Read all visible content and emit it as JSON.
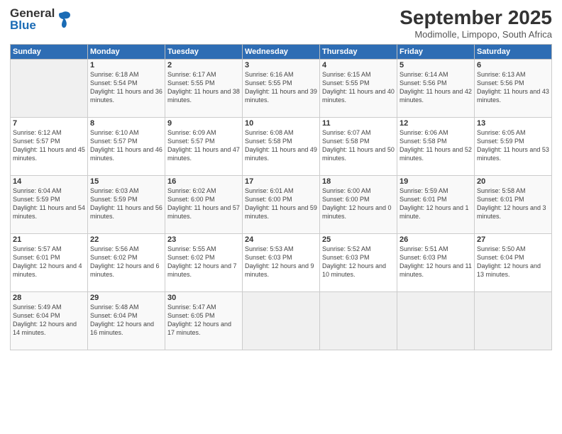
{
  "header": {
    "logo_general": "General",
    "logo_blue": "Blue",
    "month_title": "September 2025",
    "location": "Modimolle, Limpopo, South Africa"
  },
  "days_of_week": [
    "Sunday",
    "Monday",
    "Tuesday",
    "Wednesday",
    "Thursday",
    "Friday",
    "Saturday"
  ],
  "weeks": [
    [
      {
        "day": "",
        "sunrise": "",
        "sunset": "",
        "daylight": ""
      },
      {
        "day": "1",
        "sunrise": "Sunrise: 6:18 AM",
        "sunset": "Sunset: 5:54 PM",
        "daylight": "Daylight: 11 hours and 36 minutes."
      },
      {
        "day": "2",
        "sunrise": "Sunrise: 6:17 AM",
        "sunset": "Sunset: 5:55 PM",
        "daylight": "Daylight: 11 hours and 38 minutes."
      },
      {
        "day": "3",
        "sunrise": "Sunrise: 6:16 AM",
        "sunset": "Sunset: 5:55 PM",
        "daylight": "Daylight: 11 hours and 39 minutes."
      },
      {
        "day": "4",
        "sunrise": "Sunrise: 6:15 AM",
        "sunset": "Sunset: 5:55 PM",
        "daylight": "Daylight: 11 hours and 40 minutes."
      },
      {
        "day": "5",
        "sunrise": "Sunrise: 6:14 AM",
        "sunset": "Sunset: 5:56 PM",
        "daylight": "Daylight: 11 hours and 42 minutes."
      },
      {
        "day": "6",
        "sunrise": "Sunrise: 6:13 AM",
        "sunset": "Sunset: 5:56 PM",
        "daylight": "Daylight: 11 hours and 43 minutes."
      }
    ],
    [
      {
        "day": "7",
        "sunrise": "Sunrise: 6:12 AM",
        "sunset": "Sunset: 5:57 PM",
        "daylight": "Daylight: 11 hours and 45 minutes."
      },
      {
        "day": "8",
        "sunrise": "Sunrise: 6:10 AM",
        "sunset": "Sunset: 5:57 PM",
        "daylight": "Daylight: 11 hours and 46 minutes."
      },
      {
        "day": "9",
        "sunrise": "Sunrise: 6:09 AM",
        "sunset": "Sunset: 5:57 PM",
        "daylight": "Daylight: 11 hours and 47 minutes."
      },
      {
        "day": "10",
        "sunrise": "Sunrise: 6:08 AM",
        "sunset": "Sunset: 5:58 PM",
        "daylight": "Daylight: 11 hours and 49 minutes."
      },
      {
        "day": "11",
        "sunrise": "Sunrise: 6:07 AM",
        "sunset": "Sunset: 5:58 PM",
        "daylight": "Daylight: 11 hours and 50 minutes."
      },
      {
        "day": "12",
        "sunrise": "Sunrise: 6:06 AM",
        "sunset": "Sunset: 5:58 PM",
        "daylight": "Daylight: 11 hours and 52 minutes."
      },
      {
        "day": "13",
        "sunrise": "Sunrise: 6:05 AM",
        "sunset": "Sunset: 5:59 PM",
        "daylight": "Daylight: 11 hours and 53 minutes."
      }
    ],
    [
      {
        "day": "14",
        "sunrise": "Sunrise: 6:04 AM",
        "sunset": "Sunset: 5:59 PM",
        "daylight": "Daylight: 11 hours and 54 minutes."
      },
      {
        "day": "15",
        "sunrise": "Sunrise: 6:03 AM",
        "sunset": "Sunset: 5:59 PM",
        "daylight": "Daylight: 11 hours and 56 minutes."
      },
      {
        "day": "16",
        "sunrise": "Sunrise: 6:02 AM",
        "sunset": "Sunset: 6:00 PM",
        "daylight": "Daylight: 11 hours and 57 minutes."
      },
      {
        "day": "17",
        "sunrise": "Sunrise: 6:01 AM",
        "sunset": "Sunset: 6:00 PM",
        "daylight": "Daylight: 11 hours and 59 minutes."
      },
      {
        "day": "18",
        "sunrise": "Sunrise: 6:00 AM",
        "sunset": "Sunset: 6:00 PM",
        "daylight": "Daylight: 12 hours and 0 minutes."
      },
      {
        "day": "19",
        "sunrise": "Sunrise: 5:59 AM",
        "sunset": "Sunset: 6:01 PM",
        "daylight": "Daylight: 12 hours and 1 minute."
      },
      {
        "day": "20",
        "sunrise": "Sunrise: 5:58 AM",
        "sunset": "Sunset: 6:01 PM",
        "daylight": "Daylight: 12 hours and 3 minutes."
      }
    ],
    [
      {
        "day": "21",
        "sunrise": "Sunrise: 5:57 AM",
        "sunset": "Sunset: 6:01 PM",
        "daylight": "Daylight: 12 hours and 4 minutes."
      },
      {
        "day": "22",
        "sunrise": "Sunrise: 5:56 AM",
        "sunset": "Sunset: 6:02 PM",
        "daylight": "Daylight: 12 hours and 6 minutes."
      },
      {
        "day": "23",
        "sunrise": "Sunrise: 5:55 AM",
        "sunset": "Sunset: 6:02 PM",
        "daylight": "Daylight: 12 hours and 7 minutes."
      },
      {
        "day": "24",
        "sunrise": "Sunrise: 5:53 AM",
        "sunset": "Sunset: 6:03 PM",
        "daylight": "Daylight: 12 hours and 9 minutes."
      },
      {
        "day": "25",
        "sunrise": "Sunrise: 5:52 AM",
        "sunset": "Sunset: 6:03 PM",
        "daylight": "Daylight: 12 hours and 10 minutes."
      },
      {
        "day": "26",
        "sunrise": "Sunrise: 5:51 AM",
        "sunset": "Sunset: 6:03 PM",
        "daylight": "Daylight: 12 hours and 11 minutes."
      },
      {
        "day": "27",
        "sunrise": "Sunrise: 5:50 AM",
        "sunset": "Sunset: 6:04 PM",
        "daylight": "Daylight: 12 hours and 13 minutes."
      }
    ],
    [
      {
        "day": "28",
        "sunrise": "Sunrise: 5:49 AM",
        "sunset": "Sunset: 6:04 PM",
        "daylight": "Daylight: 12 hours and 14 minutes."
      },
      {
        "day": "29",
        "sunrise": "Sunrise: 5:48 AM",
        "sunset": "Sunset: 6:04 PM",
        "daylight": "Daylight: 12 hours and 16 minutes."
      },
      {
        "day": "30",
        "sunrise": "Sunrise: 5:47 AM",
        "sunset": "Sunset: 6:05 PM",
        "daylight": "Daylight: 12 hours and 17 minutes."
      },
      {
        "day": "",
        "sunrise": "",
        "sunset": "",
        "daylight": ""
      },
      {
        "day": "",
        "sunrise": "",
        "sunset": "",
        "daylight": ""
      },
      {
        "day": "",
        "sunrise": "",
        "sunset": "",
        "daylight": ""
      },
      {
        "day": "",
        "sunrise": "",
        "sunset": "",
        "daylight": ""
      }
    ]
  ]
}
